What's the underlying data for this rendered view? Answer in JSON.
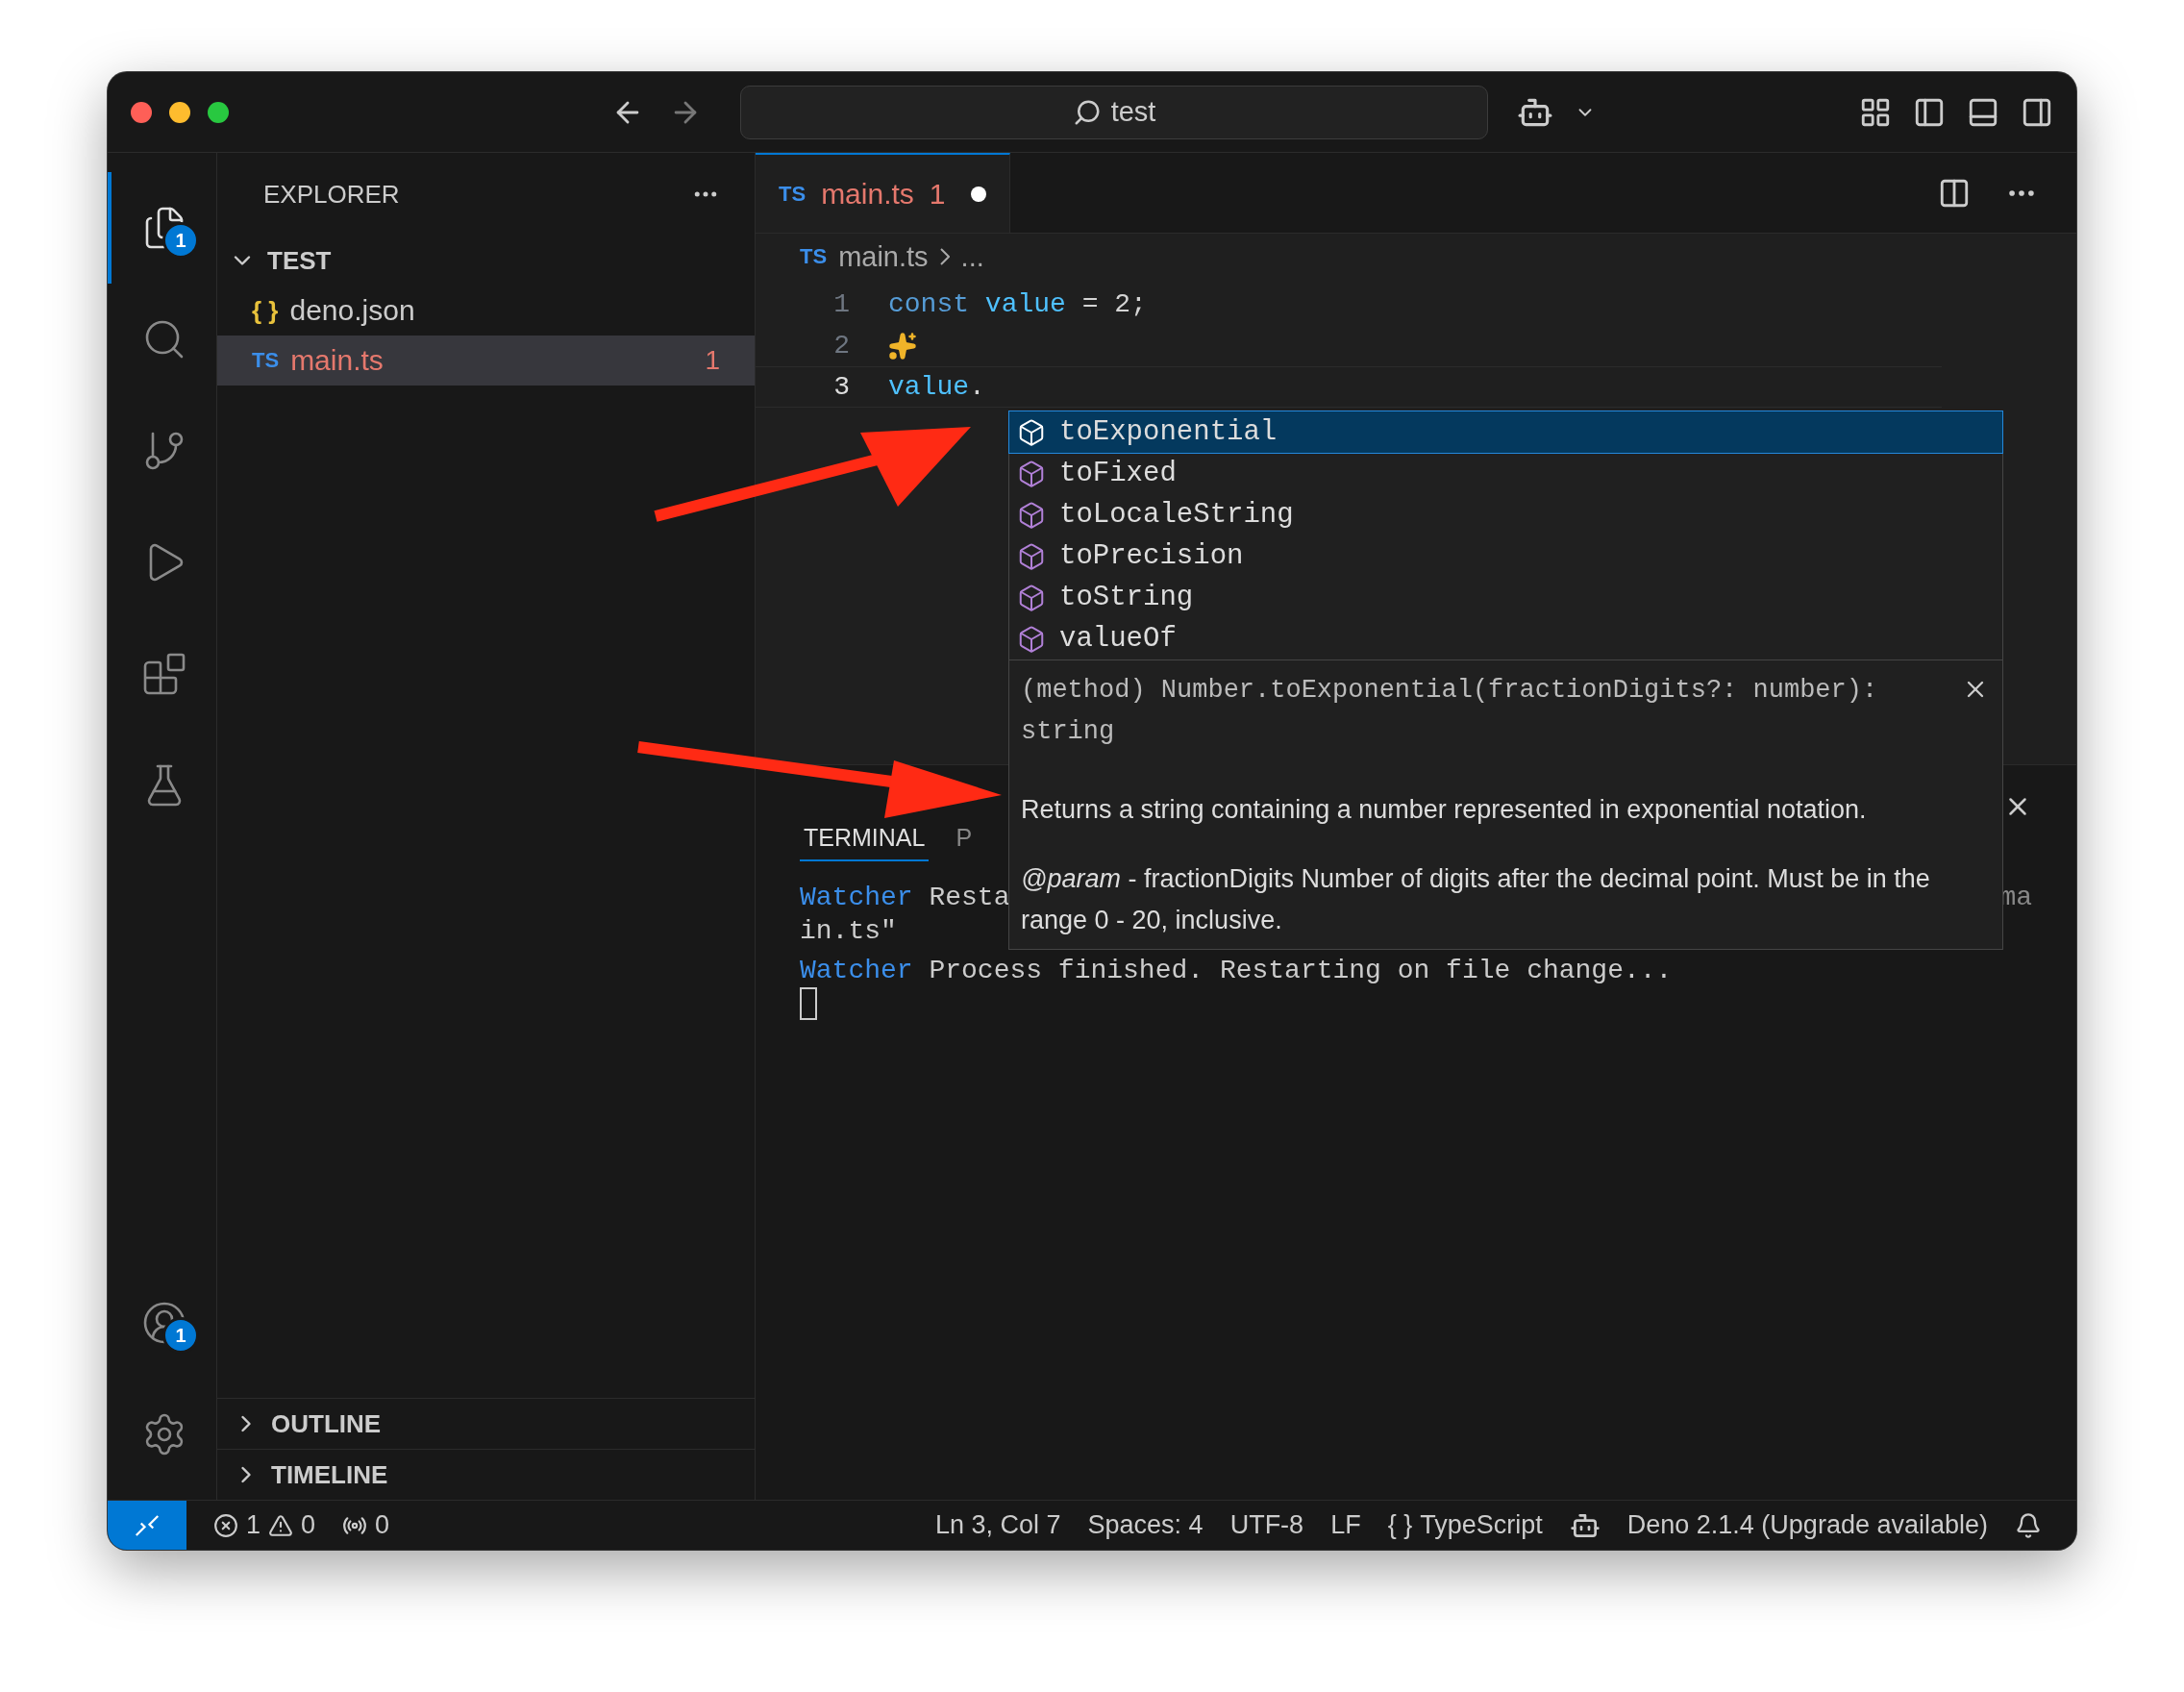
{
  "title_bar": {
    "search": "test"
  },
  "activity_bar": {
    "items": [
      {
        "kind": "explorer",
        "selected": true,
        "badge": "1"
      },
      {
        "kind": "search",
        "selected": false
      },
      {
        "kind": "source-control",
        "selected": false
      },
      {
        "kind": "run",
        "selected": false
      },
      {
        "kind": "extensions",
        "selected": false
      },
      {
        "kind": "testing",
        "selected": false
      }
    ],
    "bottom": [
      {
        "kind": "accounts",
        "badge": "1"
      },
      {
        "kind": "settings"
      }
    ]
  },
  "sidebar": {
    "title": "EXPLORER",
    "folder": {
      "name": "TEST",
      "expanded": true,
      "children": [
        {
          "name": "deno.json",
          "kind": "json",
          "icon": "{ }",
          "selected": false
        },
        {
          "name": "main.ts",
          "kind": "ts",
          "icon": "TS",
          "selected": true,
          "problems": "1"
        }
      ]
    },
    "sections": [
      {
        "name": "OUTLINE",
        "expanded": false
      },
      {
        "name": "TIMELINE",
        "expanded": false
      }
    ]
  },
  "editor": {
    "tabs": [
      {
        "icon": "TS",
        "name": "main.ts",
        "problems": "1",
        "dirty": true,
        "selected": true
      }
    ],
    "breadcrumb": {
      "icon": "TS",
      "file": "main.ts",
      "rest": "..."
    },
    "lines": [
      {
        "number": "1",
        "current": false,
        "sparkle": false,
        "tokens": [
          {
            "kind": "keyword",
            "text": "const "
          },
          {
            "kind": "variable",
            "text": "value"
          },
          {
            "kind": "plain",
            "text": " = 2;"
          }
        ]
      },
      {
        "number": "2",
        "current": false,
        "sparkle": true
      },
      {
        "number": "3",
        "current": true,
        "sparkle": false,
        "tokens": [
          {
            "kind": "variable",
            "text": "value"
          },
          {
            "kind": "plain",
            "text": "."
          }
        ]
      }
    ]
  },
  "suggest": {
    "items": [
      {
        "label": "toExponential",
        "selected": true
      },
      {
        "label": "toFixed",
        "selected": false
      },
      {
        "label": "toLocaleString",
        "selected": false
      },
      {
        "label": "toPrecision",
        "selected": false
      },
      {
        "label": "toString",
        "selected": false
      },
      {
        "label": "valueOf",
        "selected": false
      }
    ],
    "details": {
      "signature": "(method) Number.toExponential(fractionDigits?: number): string",
      "description": "Returns a string containing a number represented in exponential notation.",
      "param": "*@param* - fractionDigits Number of digits after the decimal point. Must be in the range 0 - 20, inclusive."
    }
  },
  "panel": {
    "tabs": [
      {
        "label": "TERMINAL",
        "selected": true
      },
      {
        "label": "P",
        "selected": false
      }
    ],
    "terminal": [
      {
        "tail": "ma",
        "tokens": [
          {
            "kind": "keyword",
            "text": "Watcher"
          },
          {
            "kind": "plain",
            "text": " Resta"
          }
        ]
      },
      {
        "tokens": [
          {
            "kind": "plain",
            "text": "in.ts\""
          }
        ]
      },
      {
        "tokens": [
          {
            "kind": "keyword",
            "text": "Watcher"
          },
          {
            "kind": "plain",
            "text": " Process finished. Restarting on file change..."
          }
        ]
      }
    ]
  },
  "status_bar": {
    "errors": "1",
    "warnings": "0",
    "ports": "0",
    "position": "Ln 3, Col 7",
    "indent": "Spaces: 4",
    "encoding": "UTF-8",
    "eol": "LF",
    "language_icon": "{ }",
    "language": "TypeScript",
    "deno": "Deno 2.1.4 (Upgrade available)"
  }
}
